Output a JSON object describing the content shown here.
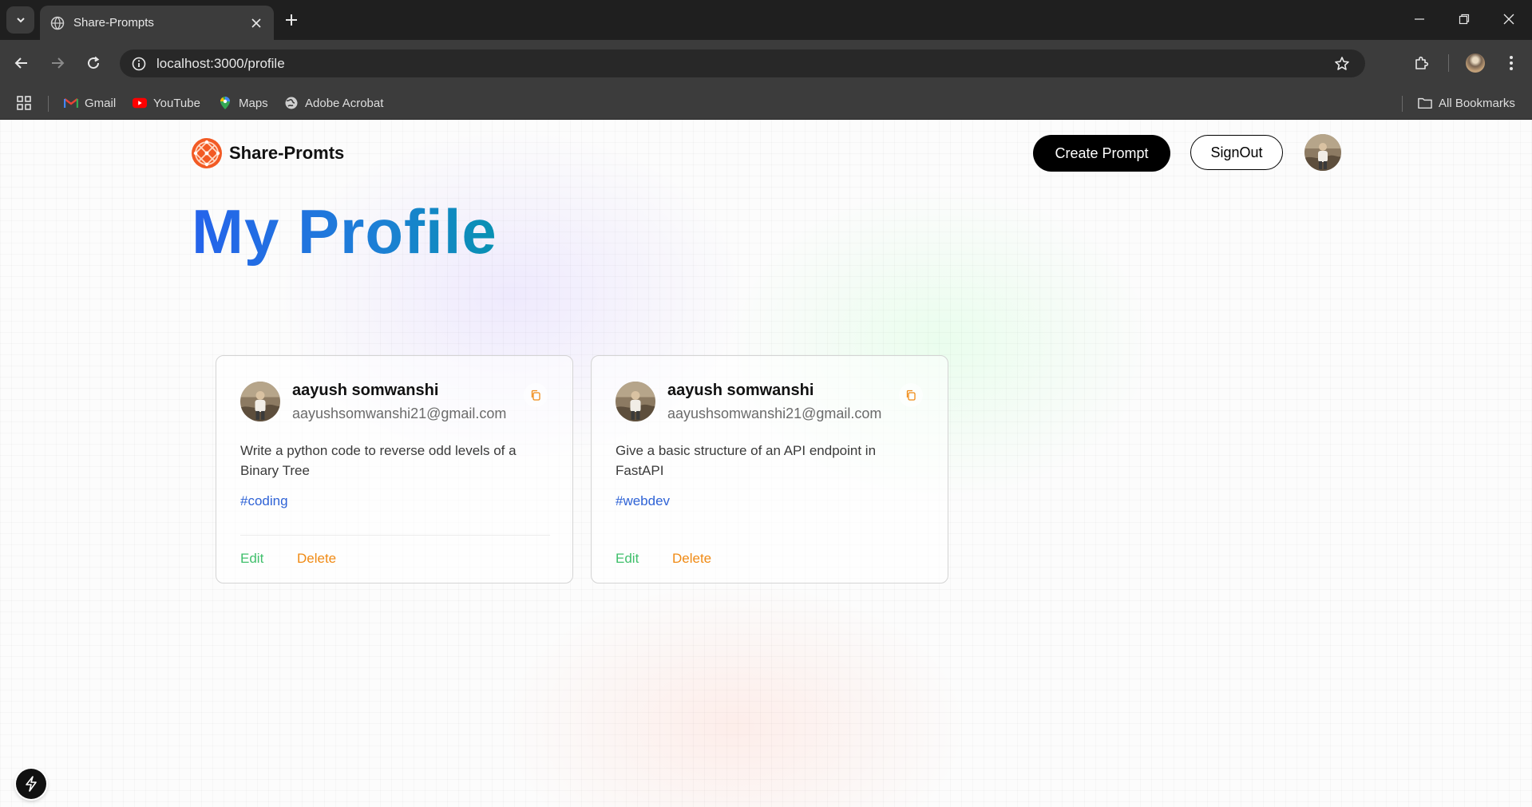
{
  "browser": {
    "tab_title": "Share-Prompts",
    "url": "localhost:3000/profile",
    "bookmarks": [
      {
        "label": "Gmail",
        "icon": "gmail-icon"
      },
      {
        "label": "YouTube",
        "icon": "youtube-icon"
      },
      {
        "label": "Maps",
        "icon": "maps-icon"
      },
      {
        "label": "Adobe Acrobat",
        "icon": "globe-icon"
      }
    ],
    "all_bookmarks_label": "All Bookmarks"
  },
  "header": {
    "logo_text": "Share-Promts",
    "create_label": "Create Prompt",
    "signout_label": "SignOut"
  },
  "page": {
    "title": "My Profile"
  },
  "prompts": [
    {
      "username": "aayush somwanshi",
      "email": "aayushsomwanshi21@gmail.com",
      "prompt": "Write a python code to reverse odd levels of a Binary Tree",
      "tag": "#coding",
      "edit_label": "Edit",
      "delete_label": "Delete"
    },
    {
      "username": "aayush somwanshi",
      "email": "aayushsomwanshi21@gmail.com",
      "prompt": "Give a basic structure of an API endpoint in FastAPI",
      "tag": "#webdev",
      "edit_label": "Edit",
      "delete_label": "Delete"
    }
  ],
  "colors": {
    "title_gradient_start": "#2563eb",
    "title_gradient_end": "#0891b2",
    "edit": "#3fbf6b",
    "delete": "#f08a14",
    "tag": "#2f63d6"
  }
}
